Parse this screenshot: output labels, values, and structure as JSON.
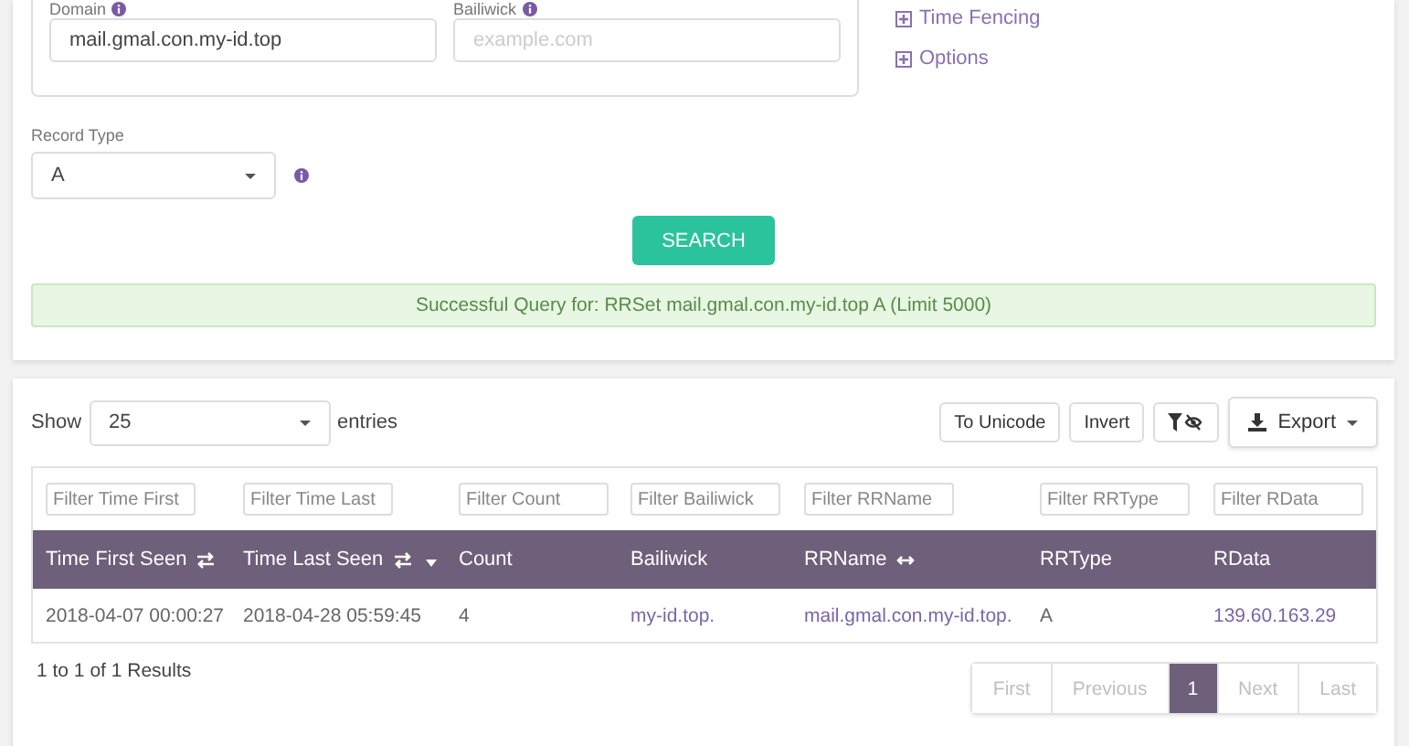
{
  "query_form": {
    "domain": {
      "label": "Domain",
      "value": "mail.gmal.con.my-id.top"
    },
    "bailiwick": {
      "label": "Bailiwick",
      "placeholder": "example.com"
    },
    "links": [
      {
        "label": "Time Fencing"
      },
      {
        "label": "Options"
      }
    ],
    "record_type": {
      "label": "Record Type",
      "value": "A"
    },
    "search_button": "SEARCH",
    "alert": "Successful Query for: RRSet mail.gmal.con.my-id.top A (Limit 5000)"
  },
  "results": {
    "length": {
      "prefix": "Show",
      "value": "25",
      "suffix": "entries"
    },
    "buttons": [
      {
        "kind": "text",
        "label": "To Unicode"
      },
      {
        "kind": "text",
        "label": "Invert"
      },
      {
        "kind": "filter-toggle"
      },
      {
        "kind": "dropdown",
        "label": "Export"
      }
    ],
    "filters": [
      {
        "placeholder": "Filter Time First"
      },
      {
        "placeholder": "Filter Time Last"
      },
      {
        "placeholder": "Filter Count"
      },
      {
        "placeholder": "Filter Bailiwick"
      },
      {
        "placeholder": "Filter RRName"
      },
      {
        "placeholder": "Filter RRType"
      },
      {
        "placeholder": "Filter RData"
      }
    ],
    "columns": [
      {
        "label": "Time First Seen",
        "kind": "swap"
      },
      {
        "label": "Time Last Seen",
        "kind": "swap-sorted"
      },
      {
        "label": "Count",
        "kind": "plain"
      },
      {
        "label": "Bailiwick",
        "kind": "plain"
      },
      {
        "label": "RRName",
        "kind": "expand"
      },
      {
        "label": "RRType",
        "kind": "plain"
      },
      {
        "label": "RData",
        "kind": "plain"
      }
    ],
    "rows": [
      {
        "cells": [
          {
            "text": "2018-04-07 00:00:27",
            "link": false
          },
          {
            "text": "2018-04-28 05:59:45",
            "link": false
          },
          {
            "text": "4",
            "link": false
          },
          {
            "text": "my-id.top.",
            "link": true
          },
          {
            "text": "mail.gmal.con.my-id.top.",
            "link": true
          },
          {
            "text": "A",
            "link": false
          },
          {
            "text": "139.60.163.29",
            "link": true
          }
        ]
      }
    ],
    "summary": "1 to 1 of 1 Results",
    "pages": [
      {
        "label": "First",
        "selected": false,
        "disabled": true
      },
      {
        "label": "Previous",
        "selected": false,
        "disabled": true
      },
      {
        "label": "1",
        "selected": true,
        "disabled": false
      },
      {
        "label": "Next",
        "selected": false,
        "disabled": true
      },
      {
        "label": "Last",
        "selected": false,
        "disabled": true
      }
    ]
  }
}
